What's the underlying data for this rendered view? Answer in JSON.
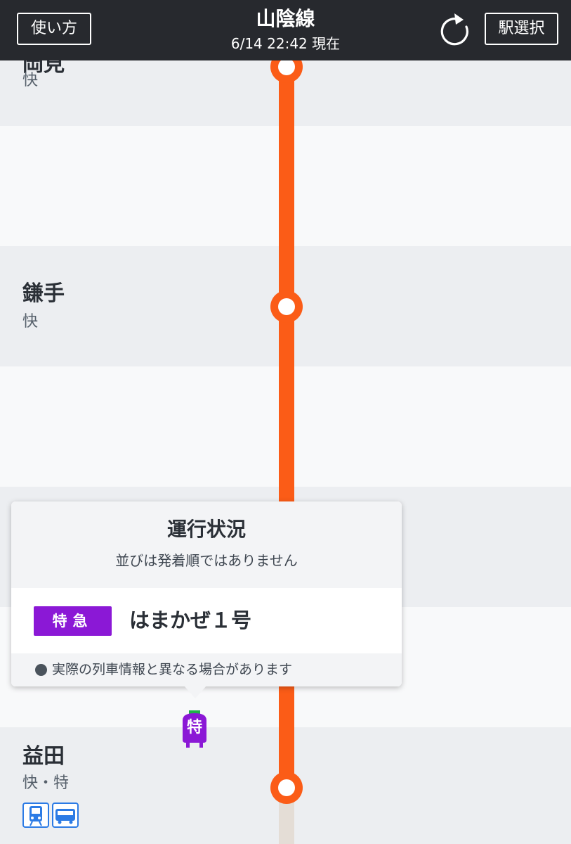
{
  "header": {
    "howto_label": "使い方",
    "title": "山陰線",
    "subtitle": "6/14 22:42 現在",
    "station_select_label": "駅選択",
    "refresh_icon": "refresh-icon"
  },
  "stations": [
    {
      "name": "岡見",
      "type": "快"
    },
    {
      "name": "鎌手",
      "type": "快"
    },
    {
      "name": "益田",
      "type": "快・特"
    }
  ],
  "popup": {
    "title": "運行状況",
    "subtitle": "並びは発着順ではありません",
    "train_class": "特急",
    "train_name": "はまかぜ１号",
    "note": "実際の列車情報と異なる場合があります"
  },
  "train_marker": {
    "label": "特"
  },
  "colors": {
    "line": "#fb5c17",
    "header_bg": "#27292e",
    "limited_express": "#8b18d6"
  }
}
